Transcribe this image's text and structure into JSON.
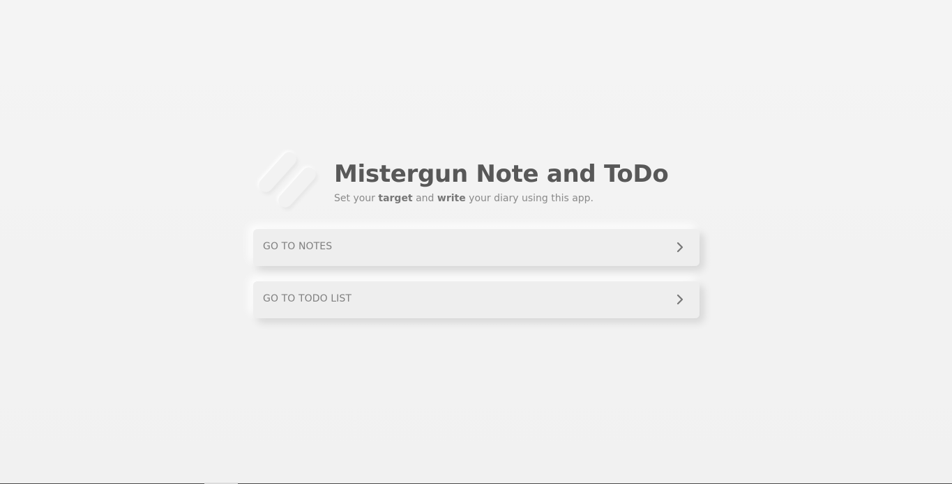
{
  "header": {
    "title": "Mistergun Note and ToDo",
    "subtitle": {
      "part1": "Set your ",
      "bold1": "target",
      "part2": " and ",
      "bold2": "write",
      "part3": " your diary using this app."
    },
    "logo_icon": "pill-stripes-logo-icon"
  },
  "nav": [
    {
      "label": "GO TO NOTES",
      "icon": "chevron-right-icon"
    },
    {
      "label": "GO TO TODO LIST",
      "icon": "chevron-right-icon"
    }
  ],
  "colors": {
    "background": "#f3f3f3",
    "card": "#eeeeee",
    "title": "#585858",
    "text": "#7f7f7f"
  }
}
